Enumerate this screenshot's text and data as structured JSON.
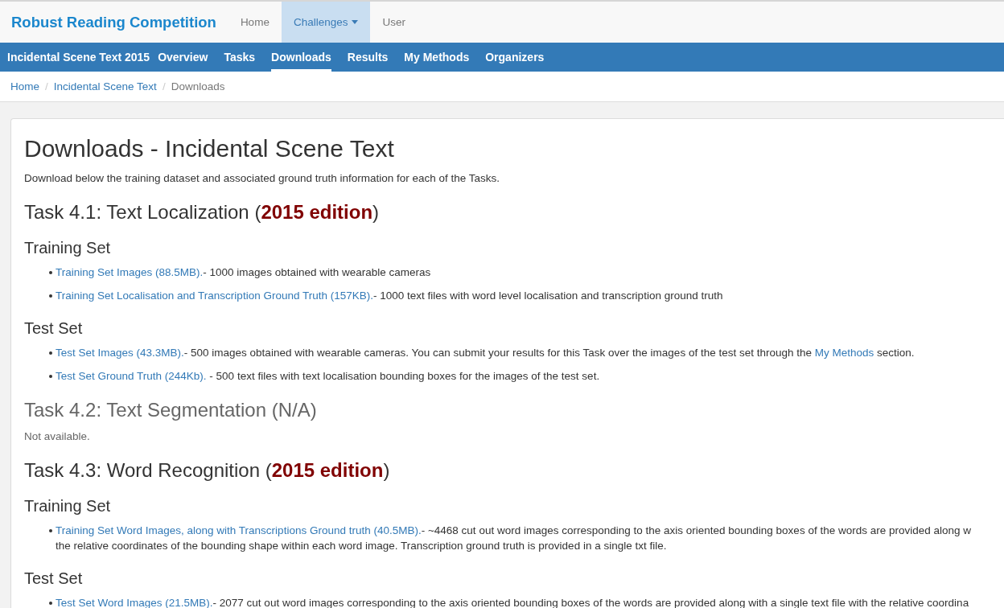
{
  "top_nav": {
    "brand": "Robust Reading Competition",
    "items": [
      {
        "label": "Home",
        "selected": false,
        "dropdown": false
      },
      {
        "label": "Challenges",
        "selected": true,
        "dropdown": true
      },
      {
        "label": "User",
        "selected": false,
        "dropdown": false
      }
    ]
  },
  "challenge_nav": {
    "title": "Incidental Scene Text 2015",
    "items": [
      {
        "label": "Overview",
        "selected": false
      },
      {
        "label": "Tasks",
        "selected": false
      },
      {
        "label": "Downloads",
        "selected": true
      },
      {
        "label": "Results",
        "selected": false
      },
      {
        "label": "My Methods",
        "selected": false
      },
      {
        "label": "Organizers",
        "selected": false
      }
    ]
  },
  "breadcrumb": {
    "separator": "/",
    "items": [
      {
        "label": "Home",
        "link": true
      },
      {
        "label": "Incidental Scene Text",
        "link": true
      },
      {
        "label": "Downloads",
        "link": false
      }
    ]
  },
  "page": {
    "title": "Downloads - Incidental Scene Text",
    "intro": "Download below the training dataset and associated ground truth information for each of the Tasks.",
    "tasks": [
      {
        "title": "Task 4.1: Text Localization (**2015 edition**)",
        "available": true,
        "sets": [
          {
            "title": "Training Set",
            "files": [
              {
                "lines": [
                  [
                    {
                      "kind": "link",
                      "text": "Training Set Images (88.5MB)."
                    },
                    {
                      "kind": "text",
                      "text": "- 1000 images obtained with wearable cameras"
                    }
                  ]
                ]
              },
              {
                "lines": [
                  [
                    {
                      "kind": "link",
                      "text": "Training Set Localisation and Transcription Ground Truth (157KB)."
                    },
                    {
                      "kind": "text",
                      "text": "- 1000 text files with word level localisation and transcription ground truth"
                    }
                  ]
                ]
              }
            ]
          },
          {
            "title": "Test Set",
            "files": [
              {
                "lines": [
                  [
                    {
                      "kind": "link",
                      "text": "Test Set Images (43.3MB)."
                    },
                    {
                      "kind": "text",
                      "text": "- 500 images obtained with wearable cameras. You can submit your results for this Task over the images of the test set through the "
                    },
                    {
                      "kind": "link",
                      "text": "My Methods"
                    },
                    {
                      "kind": "text",
                      "text": " section."
                    }
                  ]
                ]
              },
              {
                "lines": [
                  [
                    {
                      "kind": "link",
                      "text": "Test Set Ground Truth (244Kb)."
                    },
                    {
                      "kind": "text",
                      "text": " - 500 text files with text localisation bounding boxes for the images of the test set."
                    }
                  ]
                ]
              }
            ]
          }
        ]
      },
      {
        "title": "Task 4.2: Text Segmentation (N/A)",
        "available": false,
        "note": "Not available."
      },
      {
        "title": "Task 4.3: Word Recognition (**2015 edition**)",
        "available": true,
        "sets": [
          {
            "title": "Training Set",
            "files": [
              {
                "lines": [
                  [
                    {
                      "kind": "link",
                      "text": "Training Set Word Images, along with Transcriptions Ground truth (40.5MB)."
                    },
                    {
                      "kind": "text",
                      "text": "- ~4468 cut out word images corresponding to the axis oriented bounding boxes of the words are provided along w"
                    }
                  ],
                  [
                    {
                      "kind": "text",
                      "text": "the relative coordinates of the bounding shape within each word image. Transcription ground truth is provided in a single txt file."
                    }
                  ]
                ]
              }
            ]
          },
          {
            "title": "Test Set",
            "files": [
              {
                "lines": [
                  [
                    {
                      "kind": "link",
                      "text": "Test Set Word Images (21.5MB)."
                    },
                    {
                      "kind": "text",
                      "text": "- 2077 cut out word images corresponding to the axis oriented bounding boxes of the words are provided along with a single text file with the relative coordina"
                    }
                  ]
                ]
              }
            ]
          }
        ]
      }
    ]
  }
}
